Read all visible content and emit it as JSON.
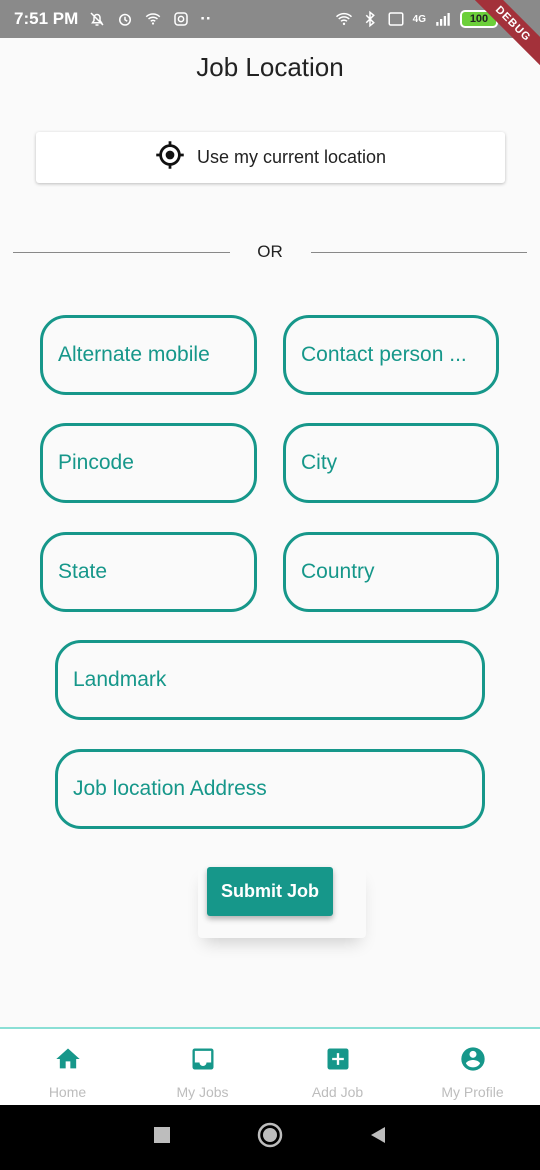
{
  "status_bar": {
    "time": "7:51 PM",
    "battery": "100",
    "debug_label": "DEBUG",
    "net_label": "4G"
  },
  "page": {
    "title": "Job Location"
  },
  "location_button": {
    "label": "Use my current location",
    "icon": "gps-fixed-icon"
  },
  "divider": {
    "label": "OR"
  },
  "fields": {
    "alternate_mobile": "Alternate mobile",
    "contact_person": "Contact person ...",
    "pincode": "Pincode",
    "city": "City",
    "state": "State",
    "country": "Country",
    "landmark": "Landmark",
    "job_location_address": "Job location Address"
  },
  "submit": {
    "label": "Submit Job"
  },
  "bottom_nav": {
    "items": [
      {
        "label": "Home",
        "icon": "home-icon"
      },
      {
        "label": "My Jobs",
        "icon": "inbox-icon"
      },
      {
        "label": "Add Job",
        "icon": "add-box-icon"
      },
      {
        "label": "My Profile",
        "icon": "account-circle-icon"
      }
    ],
    "active_index": 0
  },
  "colors": {
    "accent": "#16978a",
    "nav_icon": "#16978a",
    "nav_label": "#bdbdbd"
  }
}
